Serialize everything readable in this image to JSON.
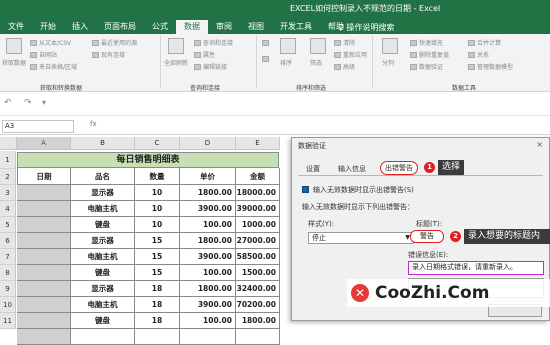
{
  "window": {
    "title": "EXCEL如何控制录入不规范的日期 - Excel",
    "tell_me": "操作说明搜索"
  },
  "tabs": [
    "文件",
    "开始",
    "插入",
    "页面布局",
    "公式",
    "数据",
    "审阅",
    "视图",
    "开发工具",
    "帮助"
  ],
  "active_tab": "数据",
  "ribbon": {
    "group1": {
      "label": "获取和转换数据",
      "big_button": "获取数据",
      "items": [
        "从文本/CSV",
        "自网站",
        "来自表格/区域",
        "最近使用的源",
        "现有连接"
      ]
    },
    "group2": {
      "label": "查询和连接",
      "big_button": "全部刷新",
      "items": [
        "查询和连接",
        "属性",
        "编辑链接"
      ]
    },
    "group3": {
      "label": "排序和筛选",
      "items": [
        "排序",
        "筛选",
        "清除",
        "重新应用",
        "高级"
      ]
    },
    "group4": {
      "label": "数据工具",
      "items": [
        "分列",
        "快速填充",
        "删除重复值",
        "数据验证",
        "合并计算",
        "关系",
        "管理数据模型"
      ]
    }
  },
  "name_box": "A3",
  "fx": "fx",
  "columns": [
    "A",
    "B",
    "C",
    "D",
    "E"
  ],
  "rows": [
    "1",
    "2",
    "3",
    "4",
    "5",
    "6",
    "7",
    "8",
    "9",
    "10",
    "11",
    "12"
  ],
  "table": {
    "title": "每日销售明细表",
    "headers": [
      "日期",
      "品名",
      "数量",
      "单价",
      "金额"
    ],
    "rows": [
      [
        "",
        "显示器",
        "10",
        "1800.00",
        "18000.00"
      ],
      [
        "",
        "电脑主机",
        "10",
        "3900.00",
        "39000.00"
      ],
      [
        "",
        "键盘",
        "10",
        "100.00",
        "1000.00"
      ],
      [
        "",
        "显示器",
        "15",
        "1800.00",
        "27000.00"
      ],
      [
        "",
        "电脑主机",
        "15",
        "3900.00",
        "58500.00"
      ],
      [
        "",
        "键盘",
        "15",
        "100.00",
        "1500.00"
      ],
      [
        "",
        "显示器",
        "18",
        "1800.00",
        "32400.00"
      ],
      [
        "",
        "电脑主机",
        "18",
        "3900.00",
        "70200.00"
      ],
      [
        "",
        "键盘",
        "18",
        "100.00",
        "1800.00"
      ]
    ]
  },
  "dialog": {
    "title": "数据验证",
    "close": "×",
    "tabs": [
      "设置",
      "输入信息",
      "出错警告"
    ],
    "active_tab": "出错警告",
    "checkbox_label": "输入无效数据时显示出错警告(S)",
    "section_label": "输入无效数据时显示下列出错警告：",
    "style_label": "样式(Y):",
    "style_value": "停止",
    "title_label": "标题(T):",
    "title_value": "警告",
    "error_label": "错误信息(E):",
    "error_value": "录入日期格式错误，请重新录入。",
    "step1": "1",
    "step2": "2",
    "callout1": "选择",
    "callout2": "录入想要的标题内"
  },
  "watermark": {
    "logo": "✕",
    "text": "CooZhi.Com"
  },
  "colors": {
    "excel_green": "#217346",
    "title_fill": "#c6e0b4",
    "callout_red": "#e02020",
    "highlight_purple": "#c026d3"
  }
}
